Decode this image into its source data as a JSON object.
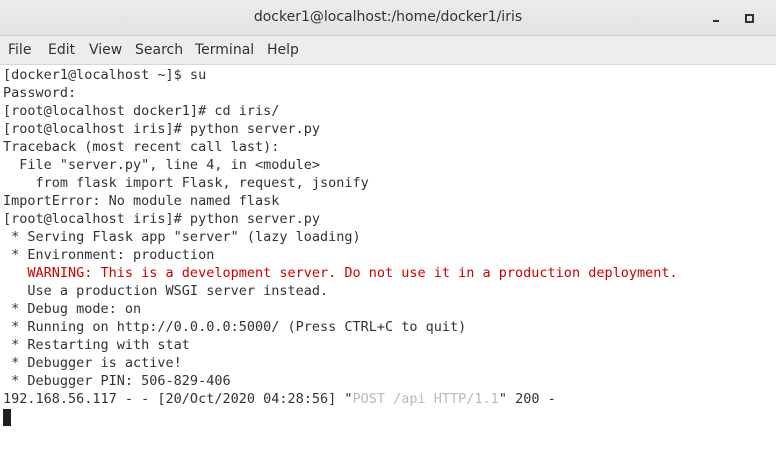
{
  "window": {
    "title": "docker1@localhost:/home/docker1/iris"
  },
  "menubar": {
    "file": "File",
    "edit": "Edit",
    "view": "View",
    "search": "Search",
    "terminal": "Terminal",
    "help": "Help"
  },
  "terminal": {
    "lines": [
      "[docker1@localhost ~]$ su",
      "Password:",
      "[root@localhost docker1]# cd iris/",
      "[root@localhost iris]# python server.py",
      "Traceback (most recent call last):",
      "  File \"server.py\", line 4, in <module>",
      "    from flask import Flask, request, jsonify",
      "ImportError: No module named flask",
      "[root@localhost iris]# python server.py",
      " * Serving Flask app \"server\" (lazy loading)",
      " * Environment: production",
      "   WARNING: This is a development server. Do not use it in a production deployment.",
      "   Use a production WSGI server instead.",
      " * Debug mode: on",
      " * Running on http://0.0.0.0:5000/ (Press CTRL+C to quit)",
      " * Restarting with stat",
      " * Debugger is active!",
      " * Debugger PIN: 506-829-406"
    ],
    "log_line": {
      "prefix": "192.168.56.117 - - [20/Oct/2020 04:28:56] \"",
      "request": "POST /api HTTP/1.1",
      "suffix": "\" 200 -"
    }
  },
  "colors": {
    "warning": "#cc0000",
    "request_text": "#b9b9b9",
    "foreground": "#2e3436"
  }
}
